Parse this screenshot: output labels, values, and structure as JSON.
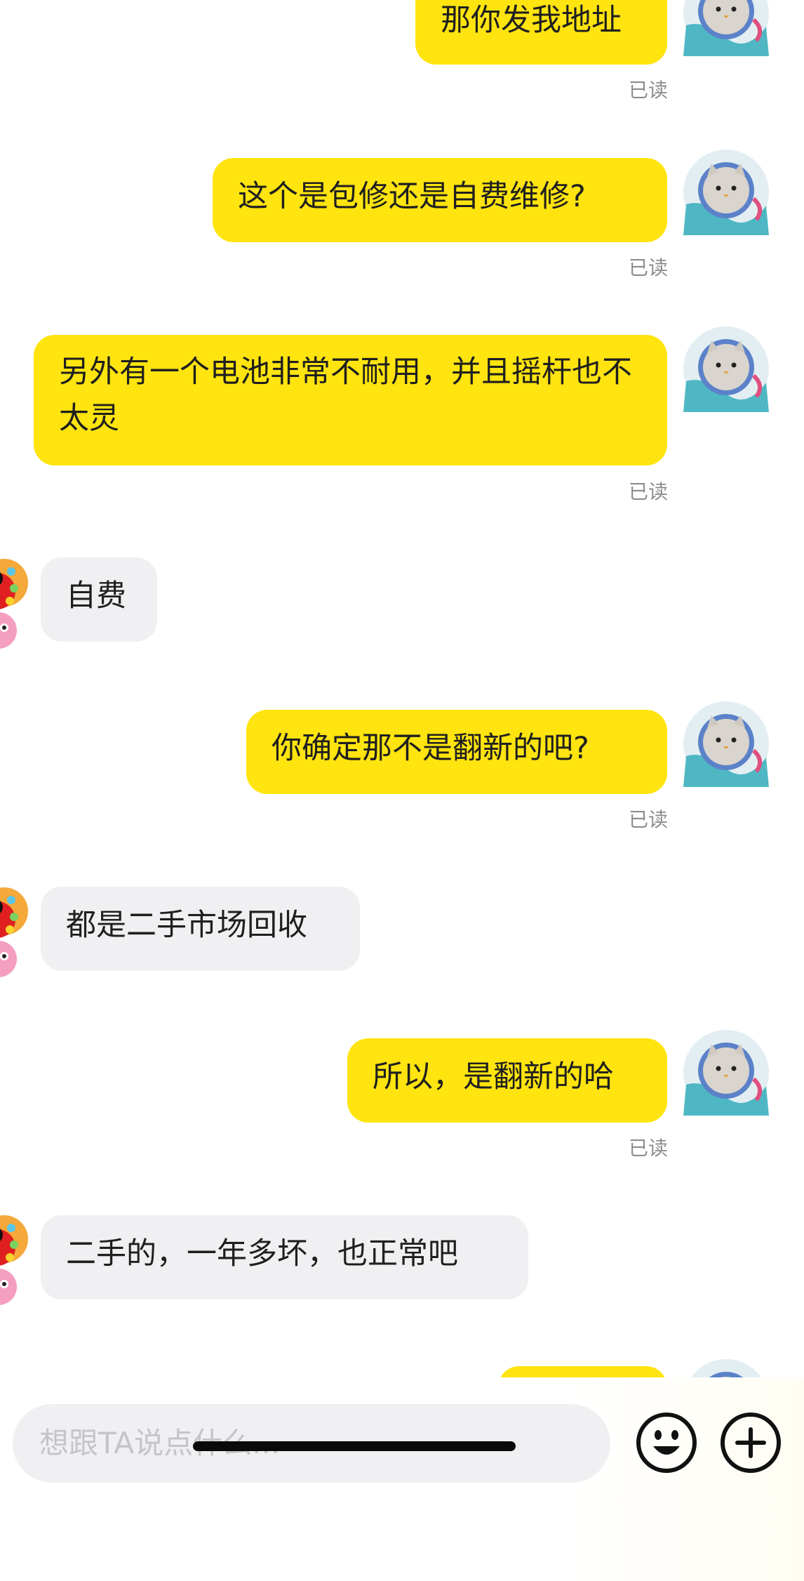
{
  "messages": [
    {
      "from": "me",
      "text": "那你发我地址",
      "read": "已读"
    },
    {
      "from": "me",
      "text": "这个是包修还是自费维修?",
      "read": "已读"
    },
    {
      "from": "me",
      "text": "另外有一个电池非常不耐用，并且摇杆也不太灵",
      "read": "已读"
    },
    {
      "from": "them",
      "text": "自费"
    },
    {
      "from": "me",
      "text": "你确定那不是翻新的吧?",
      "read": "已读"
    },
    {
      "from": "them",
      "text": "都是二手市场回收"
    },
    {
      "from": "me",
      "text": "所以，是翻新的哈",
      "read": "已读"
    },
    {
      "from": "them",
      "text": "二手的，一年多坏，也正常吧"
    }
  ],
  "input": {
    "placeholder": "想跟TA说点什么..."
  },
  "icons": {
    "emoji": "smiley-face-icon",
    "add": "plus-circle-icon"
  },
  "colors": {
    "my_bubble": "#ffe40f",
    "their_bubble": "#f0f0f2",
    "read_text": "#8d8d8d"
  }
}
